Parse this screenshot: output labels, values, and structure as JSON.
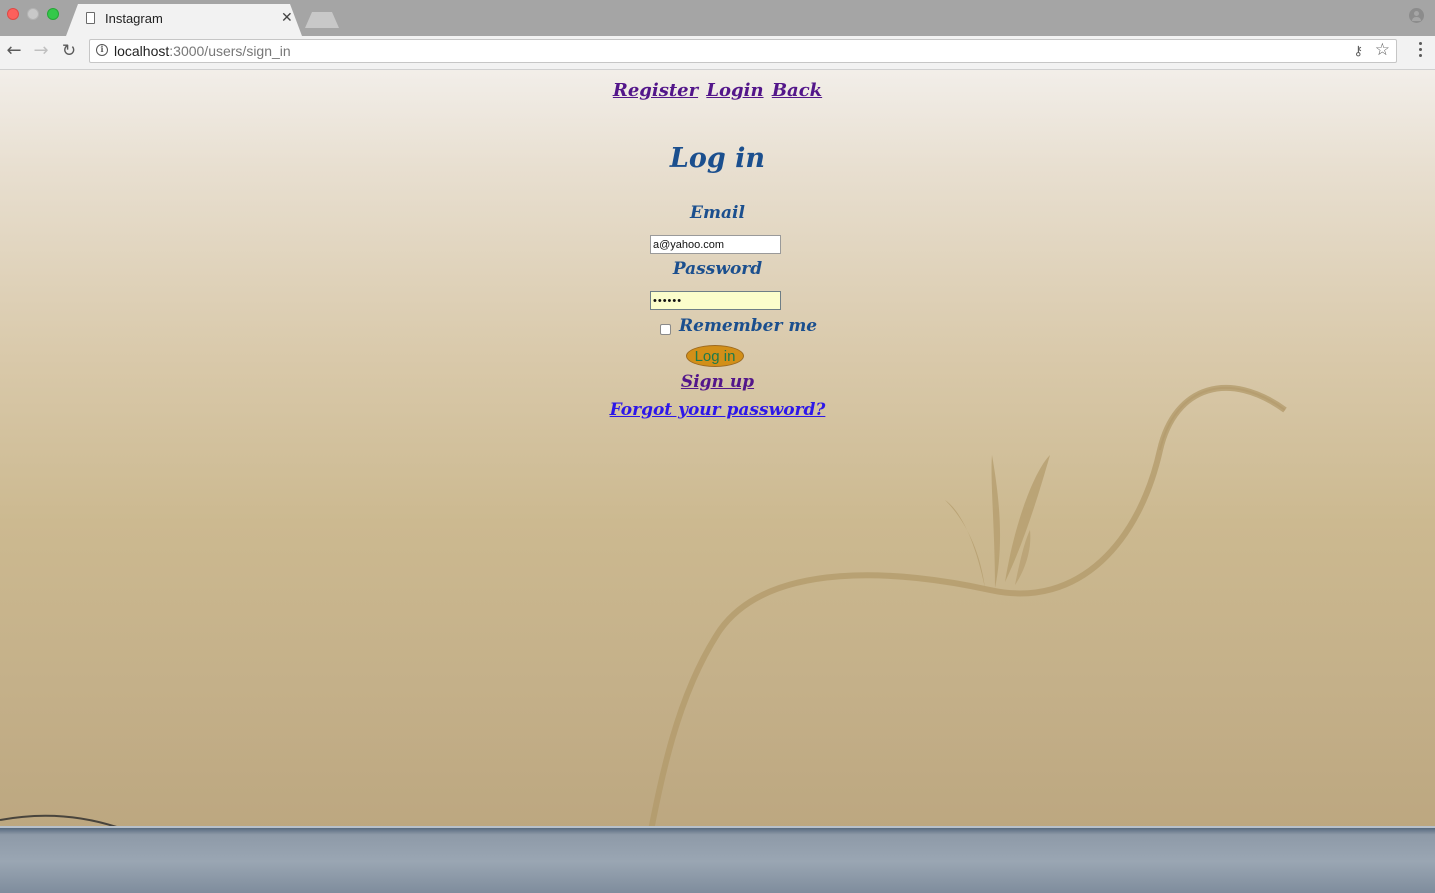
{
  "browser": {
    "tab_title": "Instagram",
    "tab_close": "✕",
    "url_host": "localhost",
    "url_path": ":3000/users/sign_in",
    "back_glyph": "←",
    "forward_glyph": "→",
    "reload_glyph": "↻",
    "key_glyph": "⚷",
    "star_glyph": "☆",
    "info_glyph": "i"
  },
  "nav": {
    "register": "Register",
    "login": "Login",
    "back": "Back"
  },
  "form": {
    "title": "Log in",
    "email_label": "Email",
    "email_value": "a@yahoo.com",
    "password_label": "Password",
    "password_value": "••••••",
    "remember_label": "Remember me",
    "submit_label": "Log in"
  },
  "links": {
    "sign_up": "Sign up",
    "forgot_password": "Forgot your password?"
  },
  "colors": {
    "heading": "#1b4f8e",
    "visited_link": "#53168a",
    "link": "#2d17e8",
    "button_fill": "#d28f18",
    "button_text": "#1e7a4a",
    "autofill": "#fbfdcb"
  }
}
